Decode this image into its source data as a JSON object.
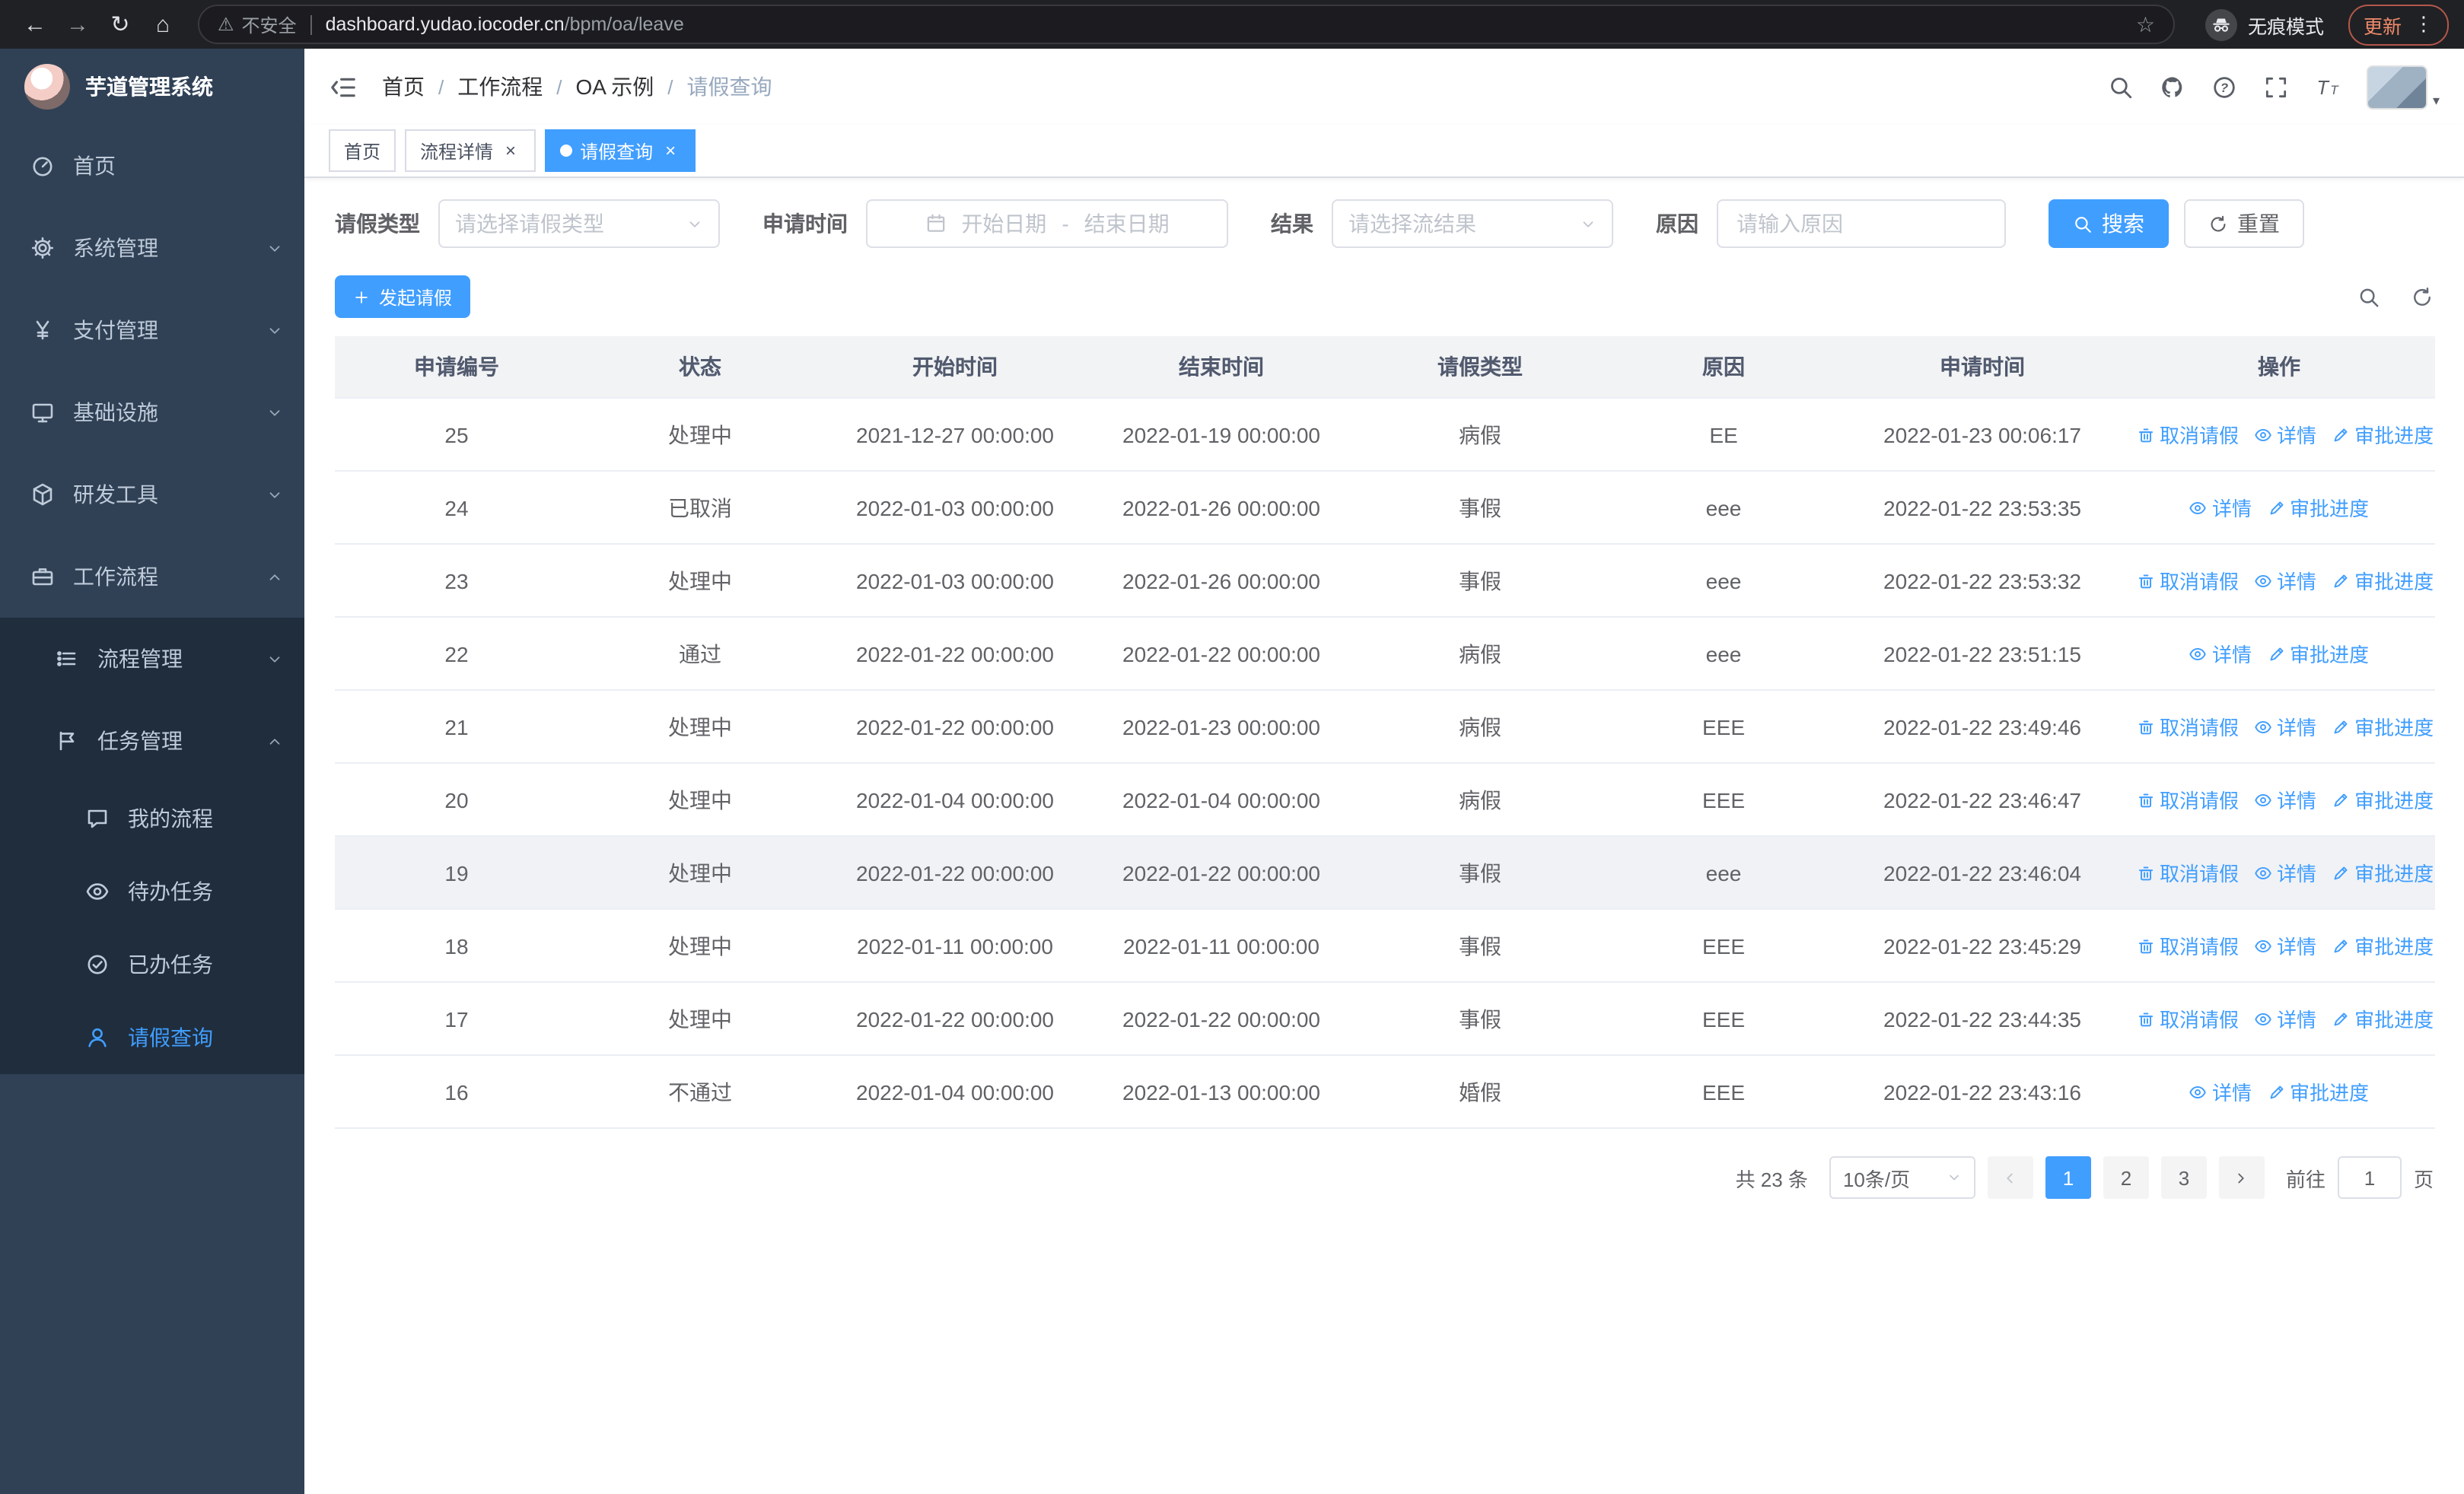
{
  "colors": {
    "accent": "#409eff",
    "sidebar_bg": "#304156",
    "submenu_bg": "#1f2d3d",
    "chrome_bg": "#202124",
    "table_header_bg": "#f2f3f5",
    "link": "#409eff",
    "update_text": "#f08b6b"
  },
  "browser": {
    "security_warning": "不安全",
    "url_host": "dashboard.yudao.iocoder.cn",
    "url_path": "/bpm/oa/leave",
    "incognito_label": "无痕模式",
    "update_label": "更新"
  },
  "sidebar": {
    "logo_title": "芋道管理系统",
    "items": [
      {
        "label": "首页",
        "icon": "dashboard-icon",
        "expandable": false
      },
      {
        "label": "系统管理",
        "icon": "gear-icon",
        "expandable": true
      },
      {
        "label": "支付管理",
        "icon": "yen-icon",
        "expandable": true
      },
      {
        "label": "基础设施",
        "icon": "monitor-icon",
        "expandable": true
      },
      {
        "label": "研发工具",
        "icon": "box-icon",
        "expandable": true
      },
      {
        "label": "工作流程",
        "icon": "briefcase-icon",
        "expandable": true,
        "expanded": true
      }
    ],
    "workflow_children": [
      {
        "label": "流程管理",
        "icon": "list-icon",
        "expandable": true
      },
      {
        "label": "任务管理",
        "icon": "flag-icon",
        "expandable": true,
        "expanded": true
      }
    ],
    "task_children": [
      {
        "label": "我的流程",
        "icon": "chat-icon"
      },
      {
        "label": "待办任务",
        "icon": "eye-icon"
      },
      {
        "label": "已办任务",
        "icon": "check-circle-icon"
      },
      {
        "label": "请假查询",
        "icon": "user-icon",
        "active": true
      }
    ]
  },
  "header": {
    "breadcrumb": [
      "首页",
      "工作流程",
      "OA 示例",
      "请假查询"
    ],
    "icon_names": [
      "search-icon",
      "github-icon",
      "help-icon",
      "fullscreen-icon",
      "font-size-icon",
      "avatar"
    ]
  },
  "tabs": [
    {
      "label": "首页",
      "closable": false,
      "active": false
    },
    {
      "label": "流程详情",
      "closable": true,
      "active": false
    },
    {
      "label": "请假查询",
      "closable": true,
      "active": true
    }
  ],
  "filters": {
    "leave_type_label": "请假类型",
    "leave_type_placeholder": "请选择请假类型",
    "apply_time_label": "申请时间",
    "start_date_placeholder": "开始日期",
    "range_separator": "-",
    "end_date_placeholder": "结束日期",
    "result_label": "结果",
    "result_placeholder": "请选择流结果",
    "reason_label": "原因",
    "reason_placeholder": "请输入原因",
    "search_label": "搜索",
    "reset_label": "重置"
  },
  "toolbar": {
    "create_label": "发起请假"
  },
  "table": {
    "columns": [
      "申请编号",
      "状态",
      "开始时间",
      "结束时间",
      "请假类型",
      "原因",
      "申请时间",
      "操作"
    ],
    "action_labels": {
      "cancel": "取消请假",
      "detail": "详情",
      "progress": "审批进度"
    },
    "rows": [
      {
        "id": "25",
        "status": "处理中",
        "start": "2021-12-27 00:00:00",
        "end": "2022-01-19 00:00:00",
        "type": "病假",
        "reason": "EE",
        "applied": "2022-01-23 00:06:17",
        "actions": [
          "cancel",
          "detail",
          "progress"
        ]
      },
      {
        "id": "24",
        "status": "已取消",
        "start": "2022-01-03 00:00:00",
        "end": "2022-01-26 00:00:00",
        "type": "事假",
        "reason": "eee",
        "applied": "2022-01-22 23:53:35",
        "actions": [
          "detail",
          "progress"
        ]
      },
      {
        "id": "23",
        "status": "处理中",
        "start": "2022-01-03 00:00:00",
        "end": "2022-01-26 00:00:00",
        "type": "事假",
        "reason": "eee",
        "applied": "2022-01-22 23:53:32",
        "actions": [
          "cancel",
          "detail",
          "progress"
        ]
      },
      {
        "id": "22",
        "status": "通过",
        "start": "2022-01-22 00:00:00",
        "end": "2022-01-22 00:00:00",
        "type": "病假",
        "reason": "eee",
        "applied": "2022-01-22 23:51:15",
        "actions": [
          "detail",
          "progress"
        ]
      },
      {
        "id": "21",
        "status": "处理中",
        "start": "2022-01-22 00:00:00",
        "end": "2022-01-23 00:00:00",
        "type": "病假",
        "reason": "EEE",
        "applied": "2022-01-22 23:49:46",
        "actions": [
          "cancel",
          "detail",
          "progress"
        ]
      },
      {
        "id": "20",
        "status": "处理中",
        "start": "2022-01-04 00:00:00",
        "end": "2022-01-04 00:00:00",
        "type": "病假",
        "reason": "EEE",
        "applied": "2022-01-22 23:46:47",
        "actions": [
          "cancel",
          "detail",
          "progress"
        ]
      },
      {
        "id": "19",
        "status": "处理中",
        "start": "2022-01-22 00:00:00",
        "end": "2022-01-22 00:00:00",
        "type": "事假",
        "reason": "eee",
        "applied": "2022-01-22 23:46:04",
        "actions": [
          "cancel",
          "detail",
          "progress"
        ],
        "highlighted": true
      },
      {
        "id": "18",
        "status": "处理中",
        "start": "2022-01-11 00:00:00",
        "end": "2022-01-11 00:00:00",
        "type": "事假",
        "reason": "EEE",
        "applied": "2022-01-22 23:45:29",
        "actions": [
          "cancel",
          "detail",
          "progress"
        ]
      },
      {
        "id": "17",
        "status": "处理中",
        "start": "2022-01-22 00:00:00",
        "end": "2022-01-22 00:00:00",
        "type": "事假",
        "reason": "EEE",
        "applied": "2022-01-22 23:44:35",
        "actions": [
          "cancel",
          "detail",
          "progress"
        ]
      },
      {
        "id": "16",
        "status": "不通过",
        "start": "2022-01-04 00:00:00",
        "end": "2022-01-13 00:00:00",
        "type": "婚假",
        "reason": "EEE",
        "applied": "2022-01-22 23:43:16",
        "actions": [
          "detail",
          "progress"
        ]
      }
    ]
  },
  "pagination": {
    "total": "共 23 条",
    "page_size": "10条/页",
    "pages": [
      "1",
      "2",
      "3"
    ],
    "active_page": "1",
    "goto_label": "前往",
    "goto_value": "1",
    "page_label": "页"
  }
}
